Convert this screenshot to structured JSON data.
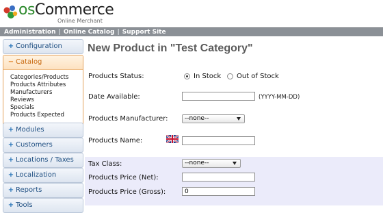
{
  "header": {
    "logo_main": "osCommerce",
    "logo_prefix": "os",
    "logo_rest": "Commerce",
    "logo_sub": "Online Merchant"
  },
  "topnav": {
    "items": [
      "Administration",
      "Online Catalog",
      "Support Site"
    ],
    "separator": "|"
  },
  "sidebar": {
    "items": [
      {
        "label": "Configuration",
        "state": "+"
      },
      {
        "label": "Catalog",
        "state": "−"
      },
      {
        "label": "Modules",
        "state": "+"
      },
      {
        "label": "Customers",
        "state": "+"
      },
      {
        "label": "Locations / Taxes",
        "state": "+"
      },
      {
        "label": "Localization",
        "state": "+"
      },
      {
        "label": "Reports",
        "state": "+"
      },
      {
        "label": "Tools",
        "state": "+"
      }
    ],
    "catalog_sub": [
      "Categories/Products",
      "Products Attributes",
      "Manufacturers",
      "Reviews",
      "Specials",
      "Products Expected"
    ]
  },
  "main": {
    "title": "New Product in \"Test Category\"",
    "status_label": "Products Status:",
    "status_options": [
      "In Stock",
      "Out of Stock"
    ],
    "status_selected": "In Stock",
    "date_label": "Date Available:",
    "date_value": "",
    "date_hint": "(YYYY-MM-DD)",
    "manufacturer_label": "Products Manufacturer:",
    "manufacturer_value": "--none--",
    "name_label": "Products Name:",
    "name_value": "",
    "tax_label": "Tax Class:",
    "tax_value": "--none--",
    "price_net_label": "Products Price (Net):",
    "price_net_value": "",
    "price_gross_label": "Products Price (Gross):",
    "price_gross_value": "0"
  },
  "colors": {
    "accent_orange": "#e07d1a",
    "nav_gray": "#8b9096",
    "price_band": "#ebebfa"
  }
}
